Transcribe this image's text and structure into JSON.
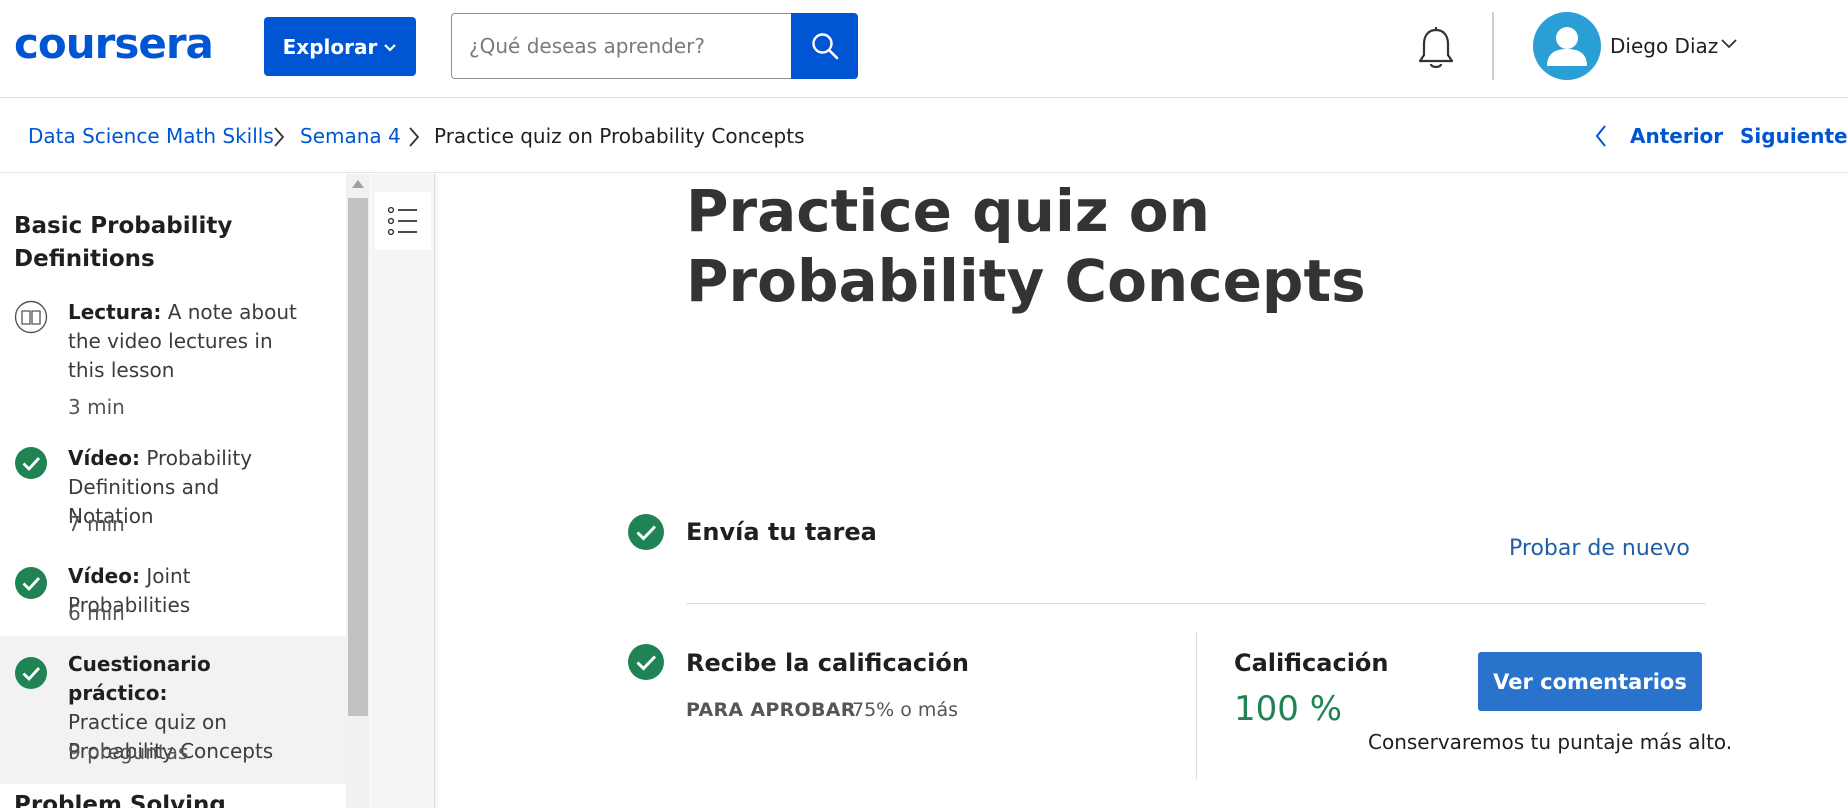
{
  "header": {
    "logo_text": "coursera",
    "explore_label": "Explorar",
    "search_placeholder": "¿Qué deseas aprender?",
    "user_name": "Diego Diaz"
  },
  "breadcrumb": {
    "items": [
      "Data Science Math Skills",
      "Semana 4",
      "Practice quiz on Probability Concepts"
    ],
    "prev_label": "Anterior",
    "next_label": "Siguiente"
  },
  "sidebar": {
    "section_title": "Basic Probability Definitions",
    "items": [
      {
        "type": "Lectura:",
        "title": "A note about the video lectures in this lesson",
        "duration": "3 min",
        "icon": "book-icon",
        "completed": false
      },
      {
        "type": "Vídeo:",
        "title": "Probability Definitions and Notation",
        "duration": "7 min",
        "icon": "check-icon",
        "completed": true
      },
      {
        "type": "Vídeo:",
        "title": "Joint Probabilities",
        "duration": "6 min",
        "icon": "check-icon",
        "completed": true
      },
      {
        "type": "Cuestionario práctico:",
        "title": "Practice quiz on Probability Concepts",
        "duration": "9 preguntas",
        "icon": "check-icon",
        "completed": true
      }
    ],
    "next_section_title": "Problem Solving"
  },
  "main": {
    "title": "Practice quiz on Probability Concepts",
    "submit_step": "Envía tu tarea",
    "retry_label": "Probar de nuevo",
    "grade_step": "Recibe la calificación",
    "pass_label": "PARA APROBAR",
    "pass_value": "75% o más",
    "grade_label": "Calificación",
    "grade_value": "100 %",
    "feedback_label": "Ver comentarios",
    "keep_note": "Conservaremos tu puntaje más alto."
  },
  "colors": {
    "brand": "#0056d2",
    "success": "#1f8354",
    "button": "#2a73cc"
  }
}
